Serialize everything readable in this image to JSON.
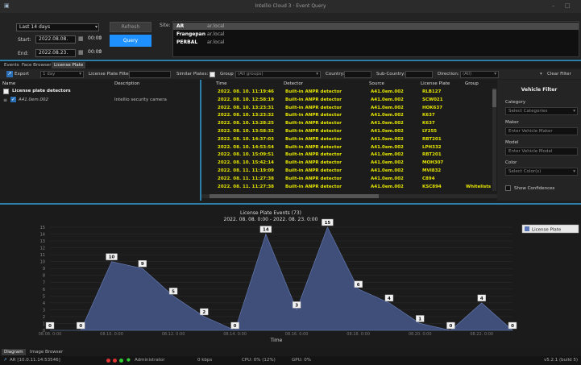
{
  "window": {
    "title": "Intellio Cloud 3 · Event Query"
  },
  "query": {
    "range_label": "Last 14 days",
    "start_label": "Start:",
    "start_date": "2022.08.08.",
    "start_time": "00:00",
    "end_label": "End:",
    "end_date": "2022.08.23.",
    "end_time": "00:00",
    "refresh_label": "Refresh",
    "query_label": "Query",
    "site_label": "Site:"
  },
  "sites": [
    {
      "name": "AR",
      "host": "ar.local",
      "selected": true
    },
    {
      "name": "Frangepan",
      "host": "ar.local",
      "selected": false
    },
    {
      "name": "PERBAL",
      "host": "ar.local",
      "selected": false
    }
  ],
  "tabs": [
    {
      "label": "Events",
      "active": false
    },
    {
      "label": "Face Browser",
      "active": false
    },
    {
      "label": "License Plate",
      "active": true
    }
  ],
  "toolbar": {
    "export_label": "Export",
    "period_value": "1 day",
    "lp_filter_label": "License Plate Filter:",
    "similar_plates_label": "Similar Plates:",
    "group_label": "Group",
    "group_value": "(All groups)",
    "country_label": "Country:",
    "subcountry_label": "Sub-Country:",
    "direction_label": "Direction:",
    "direction_value": "(All)",
    "clear_filter_label": "Clear Filter"
  },
  "detectors_tree": {
    "col_name": "Name",
    "col_description": "Description",
    "root_label": "License plate detectors",
    "item_name": "A41.0em.002",
    "item_description": "Intellio security camera"
  },
  "events_table": {
    "columns": [
      "Time",
      "Detector",
      "Source",
      "License Plate",
      "Group"
    ],
    "rows": [
      {
        "time": "2022. 08. 10. 11:19:46",
        "detector": "Built-in ANPR detector",
        "source": "A41.0em.002",
        "plate": "RLB127",
        "group": ""
      },
      {
        "time": "2022. 08. 10. 12:58:19",
        "detector": "Built-in ANPR detector",
        "source": "A41.0em.002",
        "plate": "SCW021",
        "group": ""
      },
      {
        "time": "2022. 08. 10. 13:23:31",
        "detector": "Built-in ANPR detector",
        "source": "A41.0em.002",
        "plate": "HOK637",
        "group": ""
      },
      {
        "time": "2022. 08. 10. 13:23:32",
        "detector": "Built-in ANPR detector",
        "source": "A41.0em.002",
        "plate": "K637",
        "group": ""
      },
      {
        "time": "2022. 08. 10. 13:28:25",
        "detector": "Built-in ANPR detector",
        "source": "A41.0em.002",
        "plate": "K637",
        "group": ""
      },
      {
        "time": "2022. 08. 10. 13:58:32",
        "detector": "Built-in ANPR detector",
        "source": "A41.0em.002",
        "plate": "LY255",
        "group": ""
      },
      {
        "time": "2022. 08. 10. 14:37:03",
        "detector": "Built-in ANPR detector",
        "source": "A41.0em.002",
        "plate": "RBT201",
        "group": ""
      },
      {
        "time": "2022. 08. 10. 14:53:54",
        "detector": "Built-in ANPR detector",
        "source": "A41.0em.002",
        "plate": "LPH332",
        "group": ""
      },
      {
        "time": "2022. 08. 10. 15:09:51",
        "detector": "Built-in ANPR detector",
        "source": "A41.0em.002",
        "plate": "RBT201",
        "group": ""
      },
      {
        "time": "2022. 08. 10. 15:42:14",
        "detector": "Built-in ANPR detector",
        "source": "A41.0em.002",
        "plate": "MOH307",
        "group": ""
      },
      {
        "time": "2022. 08. 11. 11:19:09",
        "detector": "Built-in ANPR detector",
        "source": "A41.0em.002",
        "plate": "MVI832",
        "group": ""
      },
      {
        "time": "2022. 08. 11. 11:27:38",
        "detector": "Built-in ANPR detector",
        "source": "A41.0em.002",
        "plate": "C894",
        "group": ""
      },
      {
        "time": "2022. 08. 11. 11:27:38",
        "detector": "Built-in ANPR detector",
        "source": "A41.0em.002",
        "plate": "KSC894",
        "group": "Whitelists"
      }
    ]
  },
  "vehicle_filter": {
    "title": "Vehicle Filter",
    "category_label": "Category",
    "category_placeholder": "Select Categories",
    "maker_label": "Maker",
    "maker_placeholder": "Enter Vehicle Maker",
    "model_label": "Model",
    "model_placeholder": "Enter Vehicle Model",
    "color_label": "Color",
    "color_placeholder": "Select Color(s)",
    "show_confidences_label": "Show Confidences"
  },
  "chart_data": {
    "type": "area",
    "title": "License Plate Events (73)",
    "subtitle": "2022. 08. 08. 0:00 - 2022. 08. 23. 0:00",
    "xlabel": "Time",
    "ylabel": "",
    "legend": "License Plate",
    "legend_position": "top-right",
    "grid": true,
    "ylim": [
      0,
      15
    ],
    "x_tick_labels": [
      "08.08. 0:00",
      "08.10. 0:00",
      "08.12. 0:00",
      "08.14. 0:00",
      "08.16. 0:00",
      "08.18. 0:00",
      "08.20. 0:00",
      "08.22. 0:00"
    ],
    "y_ticks": [
      0,
      1,
      2,
      3,
      4,
      5,
      6,
      7,
      8,
      9,
      10,
      11,
      12,
      13,
      14,
      15
    ],
    "series": [
      {
        "name": "License Plate",
        "color": "#3f4f7a",
        "x": [
          "08.08.",
          "08.09.",
          "08.10.",
          "08.11.",
          "08.12.",
          "08.13.",
          "08.14.",
          "08.15.",
          "08.16.",
          "08.17.",
          "08.18.",
          "08.19.",
          "08.20.",
          "08.21.",
          "08.22.",
          "08.23."
        ],
        "values": [
          0,
          0,
          10,
          9,
          5,
          2,
          0,
          14,
          3,
          15,
          6,
          4,
          1,
          0,
          4,
          0
        ]
      }
    ]
  },
  "bottom_tabs": [
    {
      "label": "Diagram",
      "active": true
    },
    {
      "label": "Image Browser",
      "active": false
    }
  ],
  "status": {
    "connection": "AR [10.0.11.14:53546]",
    "user": "Administrator",
    "bandwidth": "0 kbps",
    "cpu": "CPU: 0% (12%)",
    "gpu": "GPU: 0%",
    "version": "v5.2.1 (build 5)"
  },
  "colors": {
    "accent": "#2d7fa8",
    "query_button": "#1e90ff",
    "row_text": "#e6e600",
    "chart_fill": "#3f4f7a"
  }
}
